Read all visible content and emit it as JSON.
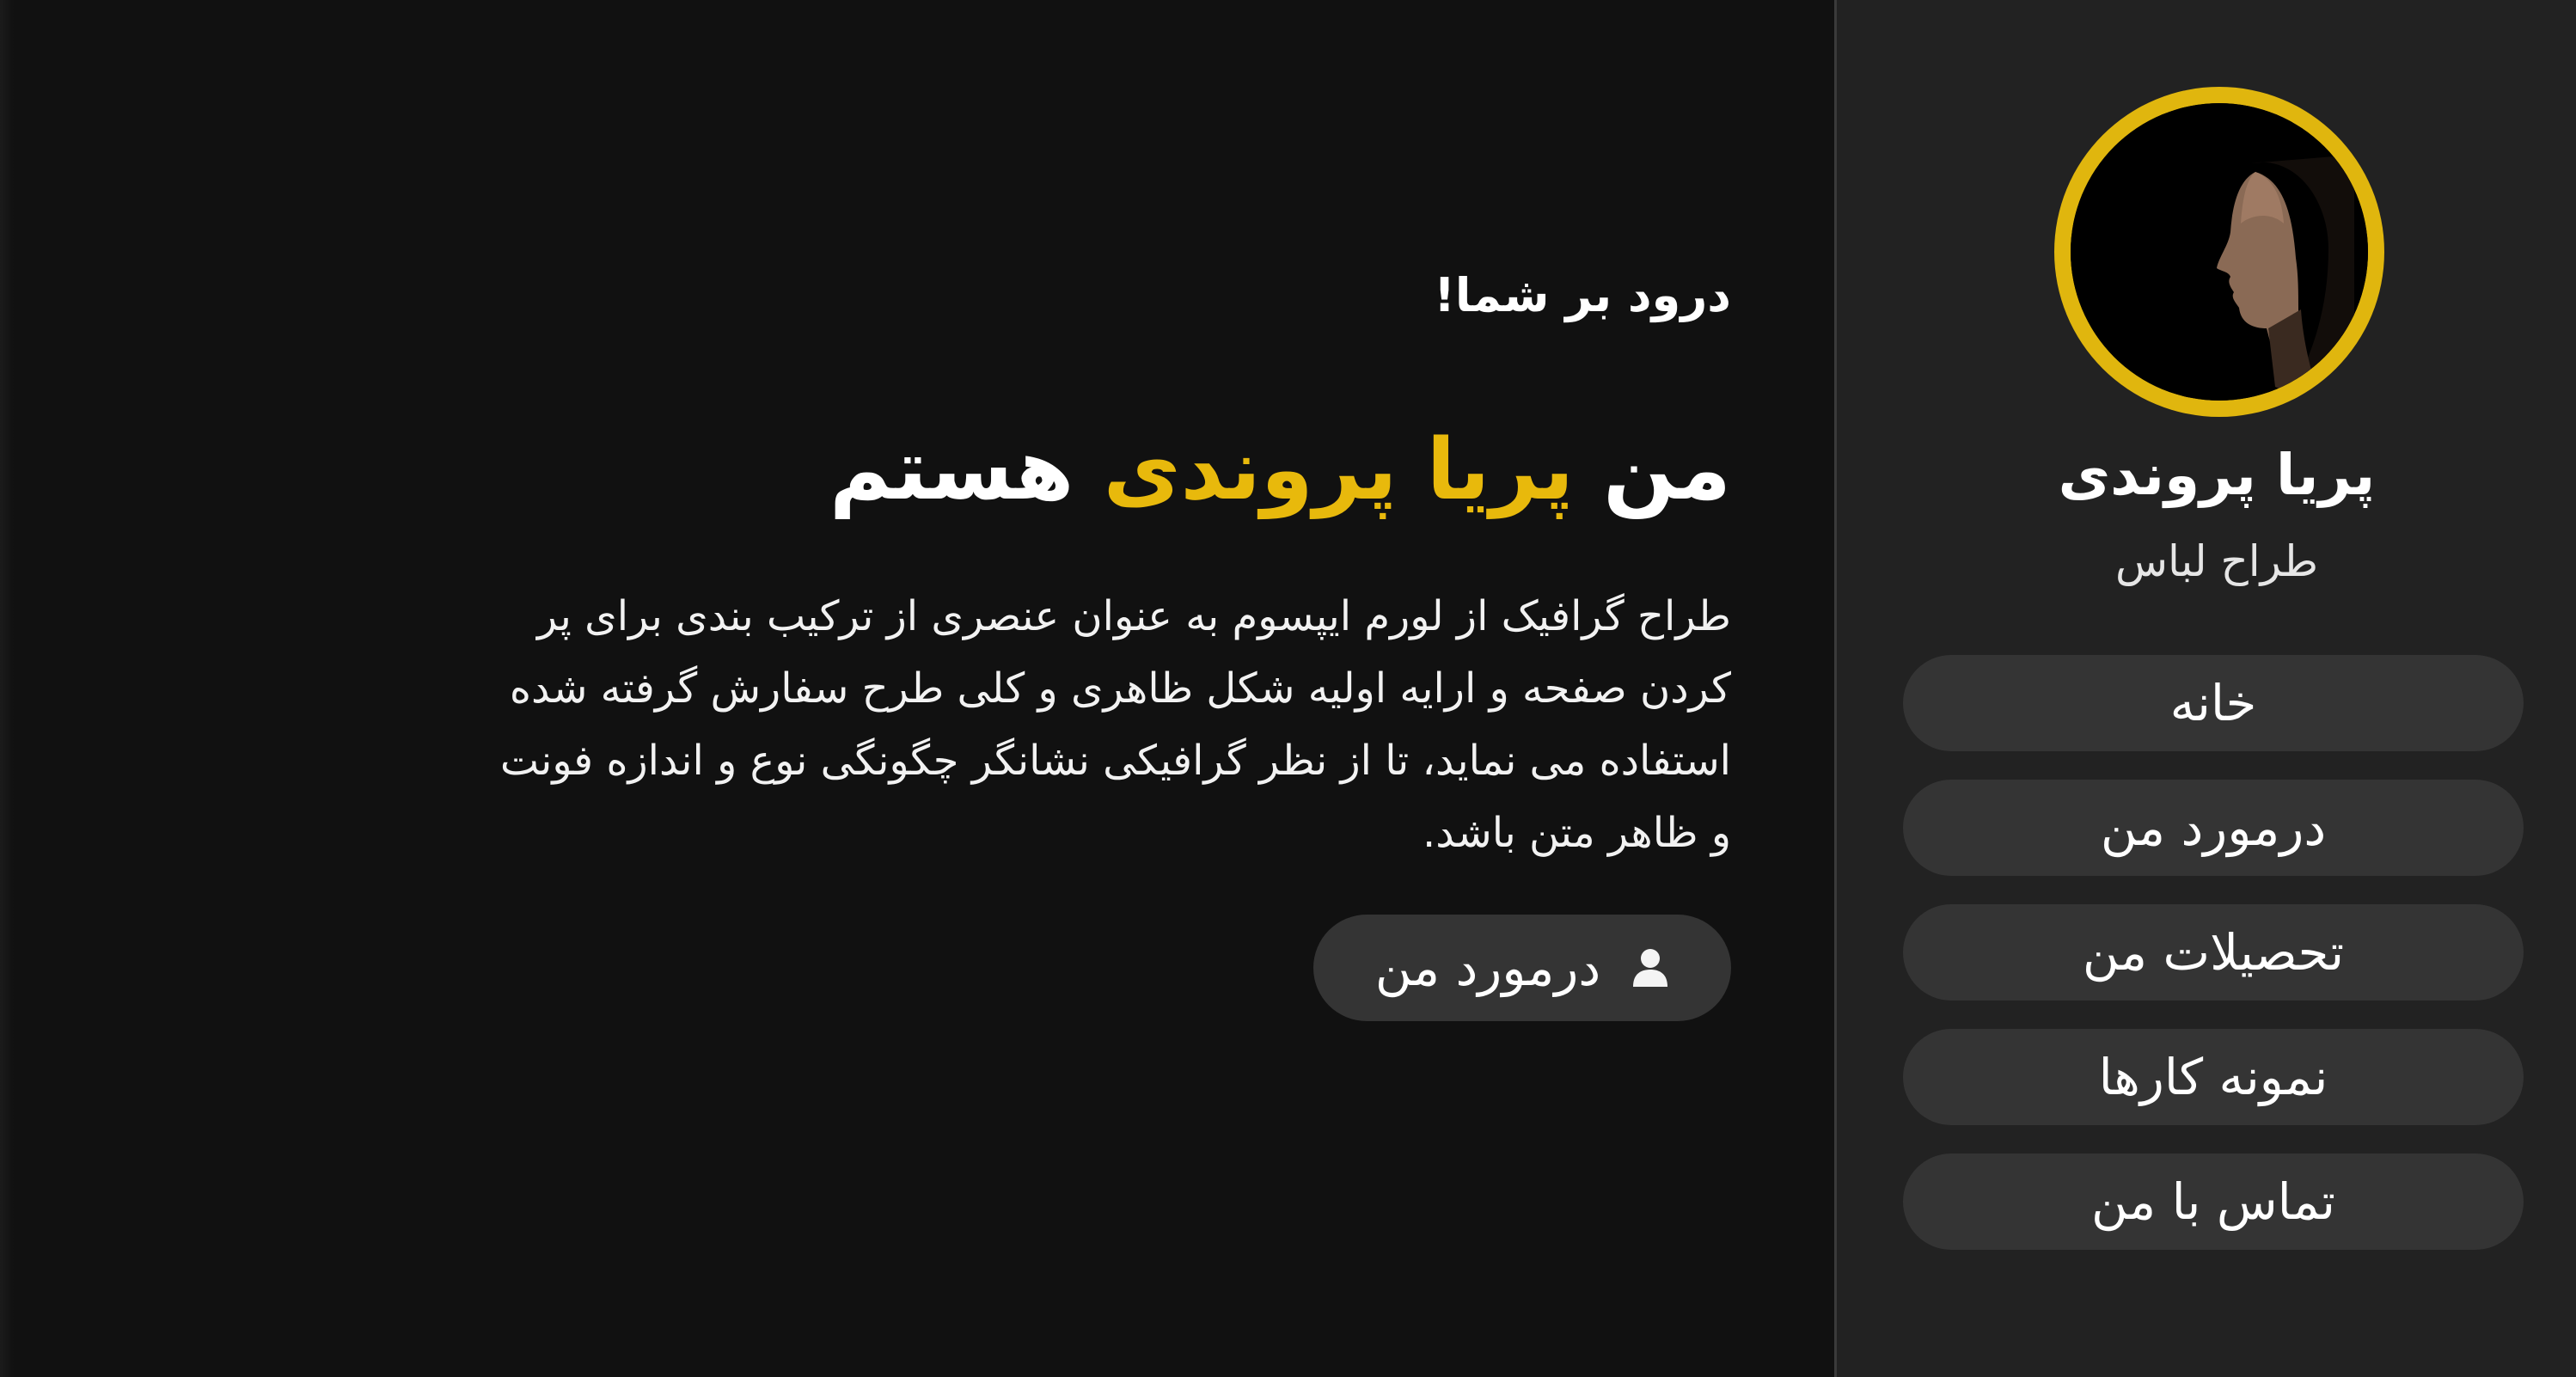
{
  "sidebar": {
    "name": "پریا پروندی",
    "role": "طراح لباس",
    "nav": [
      {
        "label": "خانه"
      },
      {
        "label": "درمورد من"
      },
      {
        "label": "تحصیلات من"
      },
      {
        "label": "نمونه کارها"
      },
      {
        "label": "تماس با من"
      }
    ]
  },
  "hero": {
    "greeting": "درود بر شما!",
    "headline_prefix": "من",
    "headline_name": "پریا پروندی",
    "headline_suffix": "هستم",
    "intro": "طراح گرافیک از لورم ایپسوم به عنوان عنصری از ترکیب بندی برای پر کردن صفحه و ارایه اولیه شکل ظاهری و کلی طرح سفارش گرفته شده استفاده می نماید، تا از نظر گرافیکی نشانگر چگونگی نوع و اندازه فونت و ظاهر متن باشد.",
    "button_label": "درمورد من",
    "button_icon": "user-icon"
  },
  "colors": {
    "accent": "#e8b90c",
    "background": "#111111",
    "sidebar": "#222222",
    "pill": "#343434"
  }
}
